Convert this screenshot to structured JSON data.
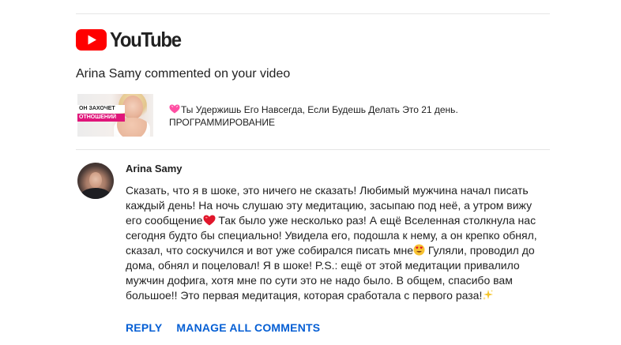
{
  "brand": {
    "logo_text": "YouTube",
    "red": "#ff0000",
    "link_color": "#065fd4",
    "logo_icon": "youtube-play-icon"
  },
  "headline": "Arina Samy commented on your video",
  "video": {
    "title_line1": "Ты Удержишь Его Навсегда, Если Будешь Делать Это 21 день.",
    "title_line2": "ПРОГРАММИРОВАНИЕ",
    "title_icon": "pink-heart-icon",
    "thumbnail_caption_1": "ОН ЗАХОЧЕТ",
    "thumbnail_caption_2": "ОТНОШЕНИЙ"
  },
  "comment": {
    "author": "Arina Samy",
    "lines": [
      "Сказать, что я в шоке, это ничего не сказать! Любимый мужчина начал писать",
      "каждый день! На ночь слушаю эту медитацию, засыпаю под неё, а утром вижу",
      "его сообщение",
      " Так было уже несколько раз! А ещё Вселенная столкнула нас",
      "сегодня будто бы специально! Увидела его, подошла к нему, а он крепко обнял,",
      "сказал, что соскучился и вот уже собирался писать мне",
      " Гуляли, проводил до",
      "дома, обнял и поцеловал! Я в шоке! P.S.: ещё от этой медитации привалило",
      "мужчин дофига, хотя мне по сути это не надо было. В общем, спасибо вам",
      "большое!! Это первая медитация, которая сработала с первого раза!"
    ],
    "emoji": {
      "heart": "red-heart-icon",
      "face": "heart-eyes-face-icon",
      "sparkles": "sparkles-icon"
    }
  },
  "actions": {
    "reply_label": "REPLY",
    "manage_label": "MANAGE ALL COMMENTS"
  }
}
